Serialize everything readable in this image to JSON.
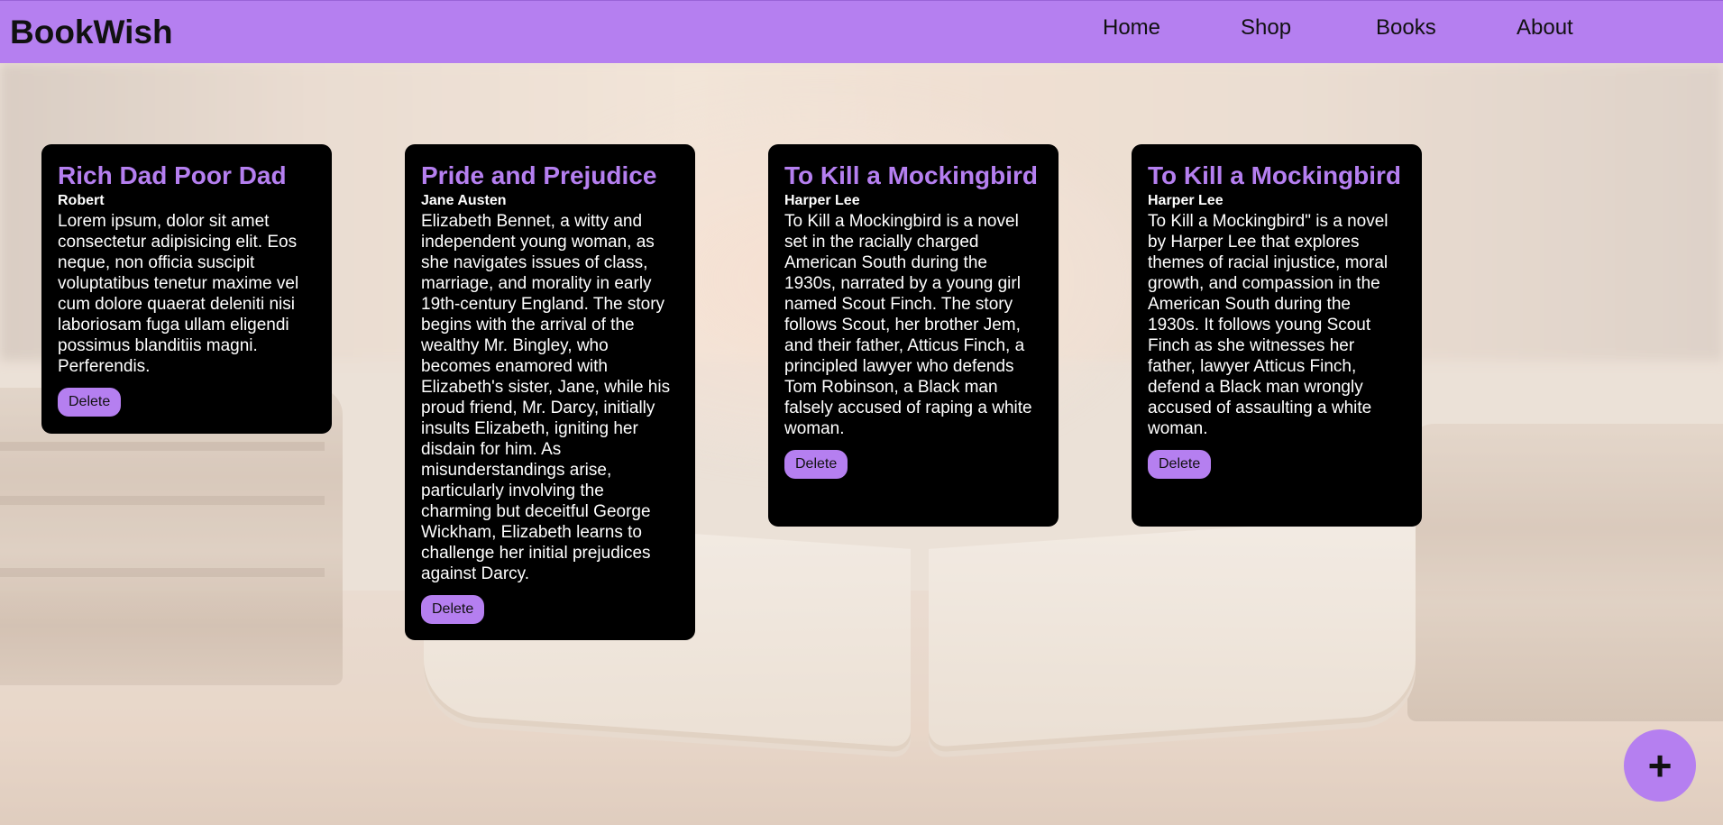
{
  "app": {
    "brand": "BookWish"
  },
  "nav": {
    "items": [
      {
        "label": "Home"
      },
      {
        "label": "Shop"
      },
      {
        "label": "Books"
      },
      {
        "label": "About"
      }
    ]
  },
  "books": [
    {
      "title": "Rich Dad Poor Dad",
      "author": "Robert",
      "description": "Lorem ipsum, dolor sit amet consectetur adipisicing elit. Eos neque, non officia suscipit voluptatibus tenetur maxime vel cum dolore quaerat deleniti nisi laboriosam fuga ullam eligendi possimus blanditiis magni. Perferendis.",
      "delete_label": "Delete"
    },
    {
      "title": "Pride and Prejudice",
      "author": "Jane Austen",
      "description": "Elizabeth Bennet, a witty and independent young woman, as she navigates issues of class, marriage, and morality in early 19th-century England. The story begins with the arrival of the wealthy Mr. Bingley, who becomes enamored with Elizabeth's sister, Jane, while his proud friend, Mr. Darcy, initially insults Elizabeth, igniting her disdain for him. As misunderstandings arise, particularly involving the charming but deceitful George Wickham, Elizabeth learns to challenge her initial prejudices against Darcy.",
      "delete_label": "Delete"
    },
    {
      "title": "To Kill a Mockingbird",
      "author": "Harper Lee",
      "description": "To Kill a Mockingbird is a novel set in the racially charged American South during the 1930s, narrated by a young girl named Scout Finch. The story follows Scout, her brother Jem, and their father, Atticus Finch, a principled lawyer who defends Tom Robinson, a Black man falsely accused of raping a white woman.",
      "delete_label": "Delete"
    },
    {
      "title": "To Kill a Mockingbird",
      "author": "Harper Lee",
      "description": "To Kill a Mockingbird\" is a novel by Harper Lee that explores themes of racial injustice, moral growth, and compassion in the American South during the 1930s. It follows young Scout Finch as she witnesses her father, lawyer Atticus Finch, defend a Black man wrongly accused of assaulting a white woman.",
      "delete_label": "Delete"
    }
  ],
  "fab": {
    "label": "+",
    "icon": "plus-icon"
  },
  "colors": {
    "accent": "#b57ff0",
    "card": "#000000",
    "text_dark": "#111111"
  }
}
